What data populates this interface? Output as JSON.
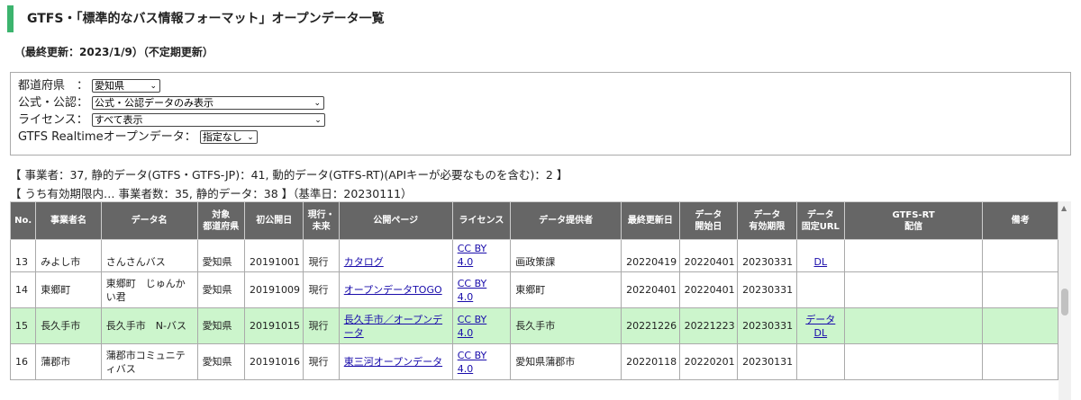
{
  "page": {
    "title": "GTFS・「標準的なバス情報フォーマット」オープンデータ一覧",
    "updated": "（最終更新：2023/1/9）（不定期更新）"
  },
  "filters": {
    "prefecture": {
      "label": "都道府県　：",
      "value": "愛知県"
    },
    "official": {
      "label": "公式・公認：",
      "value": "公式・公認データのみ表示"
    },
    "license": {
      "label": "ライセンス：",
      "value": "すべて表示"
    },
    "realtime": {
      "label": "GTFS Realtimeオープンデータ：",
      "value": "指定なし"
    }
  },
  "stats": {
    "line1": "【 事業者：37, 静的データ(GTFS・GTFS-JP)：41, 動的データ(GTFS-RT)(APIキーが必要なものを含む)：2 】",
    "line2": "【 うち有効期限内… 事業者数：35, 静的データ：38 】（基準日：20230111）"
  },
  "table": {
    "headers": [
      "No.",
      "事業者名",
      "データ名",
      "対象\n都道府県",
      "初公開日",
      "現行・\n未来",
      "公開ページ",
      "ライセンス",
      "データ提供者",
      "最終更新日",
      "データ\n開始日",
      "データ\n有効期限",
      "データ\n固定URL",
      "GTFS-RT\n配信",
      "備考"
    ],
    "rows": [
      {
        "no": "13",
        "operator": "みよし市",
        "data_name": "さんさんバス",
        "pref": "愛知県",
        "first_published": "20191001",
        "status": "現行",
        "page": "カタログ",
        "license": "CC BY 4.0",
        "provider": "画政策課",
        "last_updated": "20220419",
        "start": "20220401",
        "expire": "20230331",
        "dl": "DL",
        "rt": "",
        "note": ""
      },
      {
        "no": "14",
        "operator": "東郷町",
        "data_name": "東郷町　じゅんかい君",
        "pref": "愛知県",
        "first_published": "20191009",
        "status": "現行",
        "page": "オープンデータTOGO",
        "license": "CC BY 4.0",
        "provider": "東郷町",
        "last_updated": "20220401",
        "start": "20220401",
        "expire": "20230331",
        "dl": "",
        "rt": "",
        "note": ""
      },
      {
        "no": "15",
        "operator": "長久手市",
        "data_name": "長久手市　N-バス",
        "pref": "愛知県",
        "first_published": "20191015",
        "status": "現行",
        "page": "長久手市／オープンデータ",
        "license": "CC BY 4.0",
        "provider": "長久手市",
        "last_updated": "20221226",
        "start": "20221223",
        "expire": "20230331",
        "dl": "データDL",
        "rt": "",
        "note": ""
      },
      {
        "no": "16",
        "operator": "蒲郡市",
        "data_name": "蒲郡市コミュニティバス",
        "pref": "愛知県",
        "first_published": "20191016",
        "status": "現行",
        "page": "東三河オープンデータ",
        "license": "CC BY 4.0",
        "provider": "愛知県蒲郡市",
        "last_updated": "20220118",
        "start": "20220201",
        "expire": "20230131",
        "dl": "",
        "rt": "",
        "note": ""
      }
    ]
  },
  "colors": {
    "accent": "#3cb46e",
    "header_bg": "#666666",
    "highlight_row": "#ccf5cc",
    "link": "#1a0dab"
  }
}
